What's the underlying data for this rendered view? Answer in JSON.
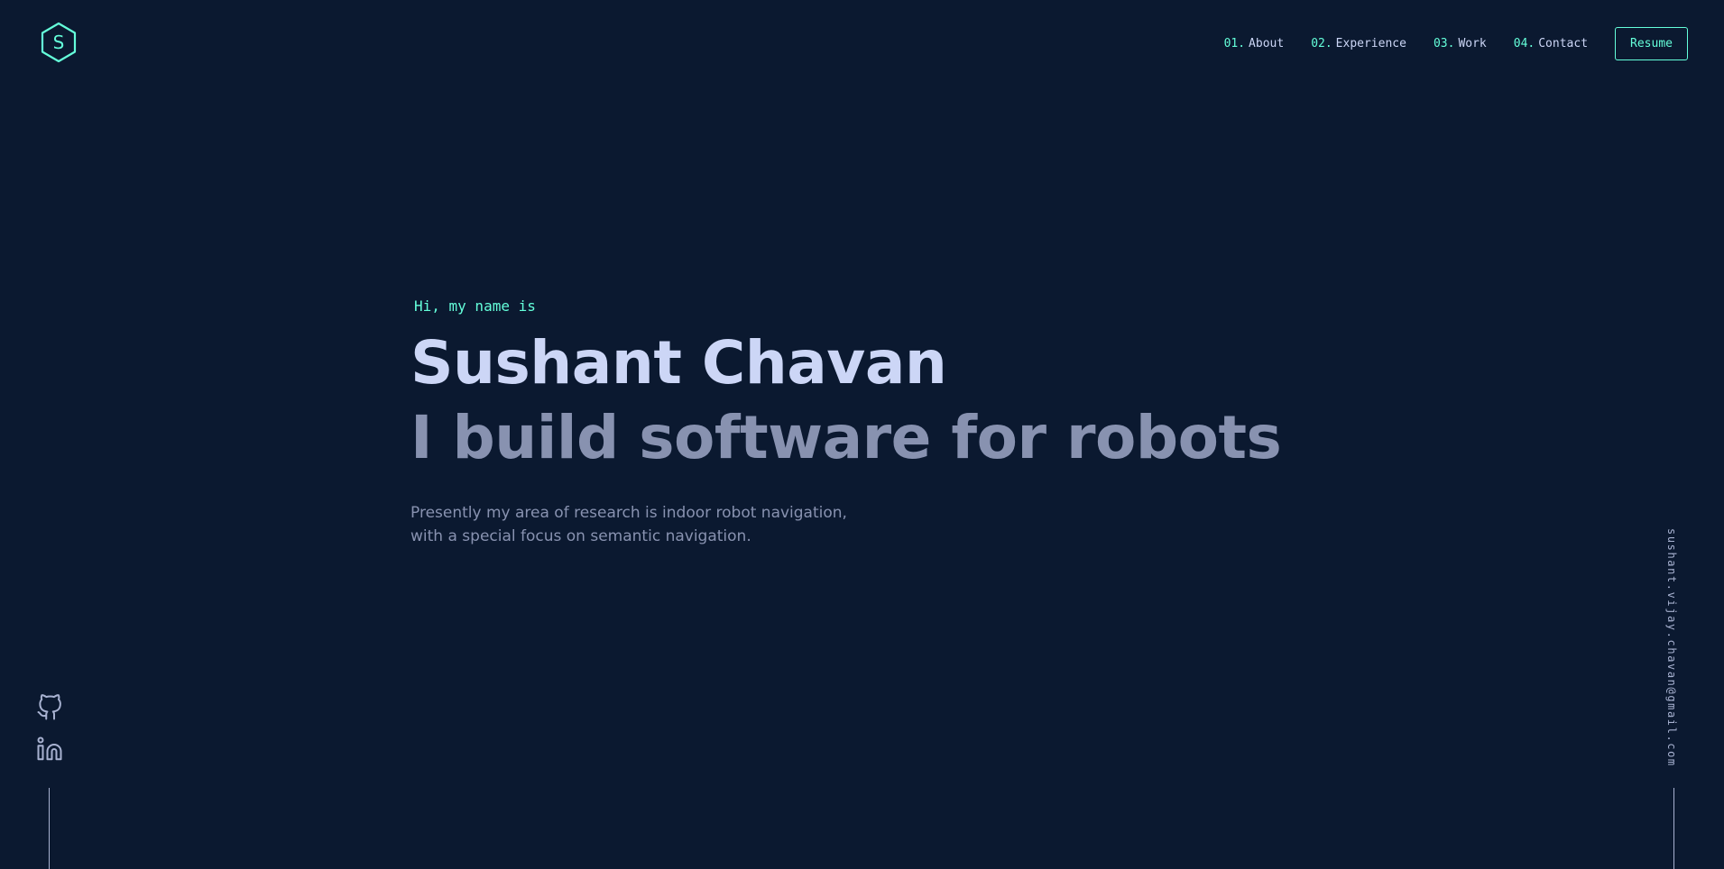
{
  "header": {
    "logo_letter": "S",
    "nav": [
      {
        "num": "01.",
        "label": "About"
      },
      {
        "num": "02.",
        "label": "Experience"
      },
      {
        "num": "03.",
        "label": "Work"
      },
      {
        "num": "04.",
        "label": "Contact"
      }
    ],
    "resume_label": "Resume"
  },
  "hero": {
    "greeting": "Hi, my name is",
    "name": "Sushant Chavan",
    "tagline": "I build software for robots",
    "intro": "Presently my area of research is indoor robot navigation, with a special focus on semantic navigation."
  },
  "social": {
    "items": [
      {
        "icon": "github-icon"
      },
      {
        "icon": "linkedin-icon"
      }
    ]
  },
  "email": "sushant.vijay.chavan@gmail.com",
  "colors": {
    "background": "#0b1930",
    "accent": "#64ffda",
    "heading": "#ccd6f6",
    "muted": "#8892b0"
  }
}
